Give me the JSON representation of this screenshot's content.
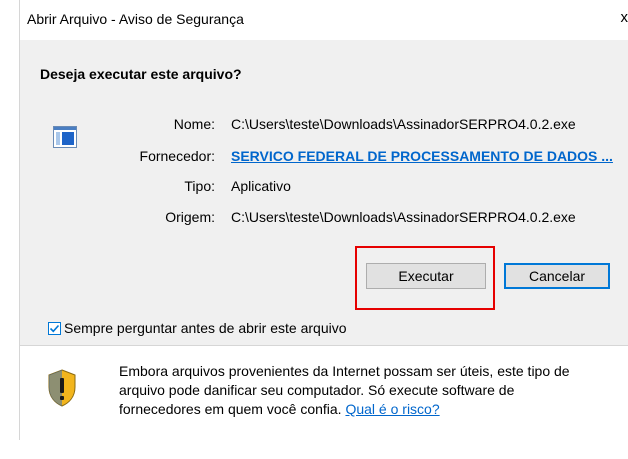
{
  "window": {
    "title": "Abrir Arquivo - Aviso de Segurança",
    "close_glyph": "x"
  },
  "dialog": {
    "question": "Deseja executar este arquivo?",
    "app_icon": "application-window-icon",
    "fields": {
      "name_label": "Nome:",
      "name_value": "C:\\Users\\teste\\Downloads\\AssinadorSERPRO4.0.2.exe",
      "publisher_label": "Fornecedor:",
      "publisher_value": "SERVICO FEDERAL DE PROCESSAMENTO DE DADOS ...",
      "type_label": "Tipo:",
      "type_value": "Aplicativo",
      "origin_label": "Origem:",
      "origin_value": "C:\\Users\\teste\\Downloads\\AssinadorSERPRO4.0.2.exe"
    },
    "buttons": {
      "run": "Executar",
      "cancel": "Cancelar"
    },
    "checkbox": {
      "label": "Sempre perguntar antes de abrir este arquivo",
      "checked": true
    }
  },
  "footer": {
    "icon": "security-shield-warning-icon",
    "line1": "Embora arquivos provenientes da Internet possam ser úteis, este tipo de",
    "line2": "arquivo pode danificar seu computador. Só execute software de",
    "line3_text": "fornecedores em quem você confia. ",
    "risk_link": "Qual é o risco?"
  },
  "colors": {
    "link": "#0066cc",
    "highlight": "#e60000",
    "focus": "#0078d7",
    "panel": "#f0f0f0"
  }
}
